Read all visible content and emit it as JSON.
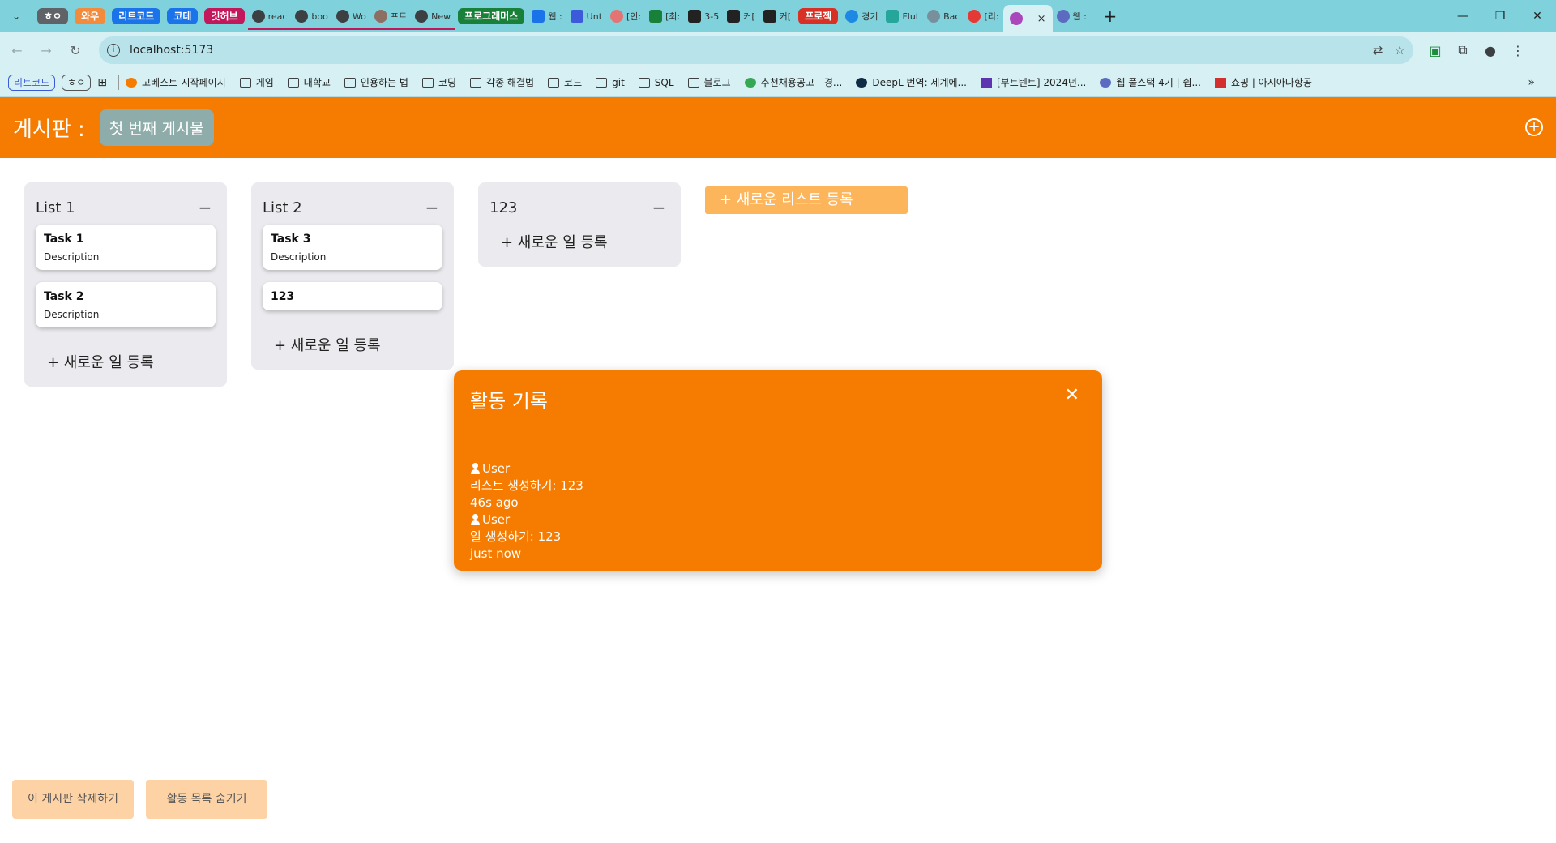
{
  "browser": {
    "tab_groups": [
      {
        "label": "ㅎㅇ",
        "color": "#5f6368"
      },
      {
        "label": "와우",
        "color": "#f28b3b"
      },
      {
        "label": "리트코드",
        "color": "#1a73e8"
      },
      {
        "label": "코테",
        "color": "#1a73e8"
      },
      {
        "label": "깃허브",
        "color": "#c2185b"
      }
    ],
    "tabs_after_groups": [
      "reac",
      "boo",
      "Wo",
      "프트",
      "New"
    ],
    "group2": {
      "label": "프로그래머스",
      "color": "#188038"
    },
    "tabs_group2": [
      "웹 :",
      "Unt",
      "[인:",
      "[최:",
      "3-5",
      "커[",
      "커["
    ],
    "group3": {
      "label": "프로젝",
      "color": "#d93025"
    },
    "tabs_group3": [
      "경기",
      "Flut",
      "Bac",
      "[리:"
    ],
    "active_tab_close": "×",
    "tab_last": "웹 :",
    "new_tab": "+",
    "url": "localhost:5173"
  },
  "bookmarks": {
    "chips": [
      "리트코드",
      "ㅎㅇ"
    ],
    "items": [
      {
        "label": "고베스트-시작페이지",
        "icon": "app-icon"
      },
      {
        "label": "게임",
        "icon": "folder-icon"
      },
      {
        "label": "대학교",
        "icon": "folder-icon"
      },
      {
        "label": "인용하는 법",
        "icon": "folder-icon"
      },
      {
        "label": "코딩",
        "icon": "folder-icon"
      },
      {
        "label": "각종 해결법",
        "icon": "folder-icon"
      },
      {
        "label": "코드",
        "icon": "folder-icon"
      },
      {
        "label": "git",
        "icon": "folder-icon"
      },
      {
        "label": "SQL",
        "icon": "folder-icon"
      },
      {
        "label": "블로그",
        "icon": "folder-icon"
      },
      {
        "label": "추천채용공고 - 경...",
        "icon": "app-icon"
      },
      {
        "label": "DeepL 번역: 세계에...",
        "icon": "app-icon"
      },
      {
        "label": "[부트텐트] 2024년...",
        "icon": "app-icon"
      },
      {
        "label": "웹 풀스택 4기 | 쉽...",
        "icon": "app-icon"
      },
      {
        "label": "쇼핑 | 아시아나항공",
        "icon": "app-icon"
      }
    ],
    "more": "»"
  },
  "app": {
    "header_title": "게시판 :",
    "board_name": "첫 번째 게시물",
    "add_board_icon": "plus-circle-icon",
    "lists": [
      {
        "title": "List 1",
        "min": "−",
        "cards": [
          {
            "title": "Task 1",
            "desc": "Description"
          },
          {
            "title": "Task 2",
            "desc": "Description"
          }
        ],
        "add": "+ 새로운 일 등록"
      },
      {
        "title": "List 2",
        "min": "−",
        "cards": [
          {
            "title": "Task 3",
            "desc": "Description"
          },
          {
            "title": "123",
            "desc": ""
          }
        ],
        "add": "+ 새로운 일 등록"
      },
      {
        "title": "123",
        "min": "−",
        "cards": [],
        "add": "+ 새로운 일 등록"
      }
    ],
    "new_list": "+ 새로운 리스트 등록",
    "activity": {
      "title": "활동 기록",
      "close": "✕",
      "entries": [
        {
          "user": "User",
          "action": "리스트 생성하기: 123",
          "time": "46s ago"
        },
        {
          "user": "User",
          "action": "일 생성하기: 123",
          "time": "just now"
        }
      ]
    },
    "footer": {
      "delete_board": "이 게시판 삭제하기",
      "hide_activity": "활동 목록 숨기기"
    }
  }
}
